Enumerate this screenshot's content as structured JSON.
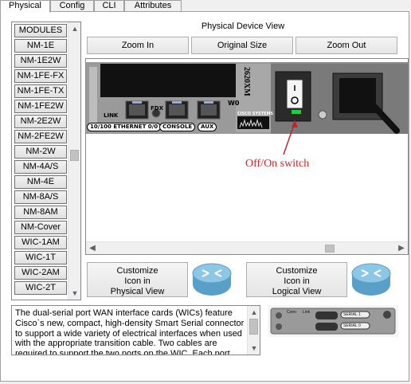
{
  "tabs": [
    {
      "label": "Physical",
      "active": true
    },
    {
      "label": "Config",
      "active": false
    },
    {
      "label": "CLI",
      "active": false
    },
    {
      "label": "Attributes",
      "active": false
    }
  ],
  "modules": [
    "MODULES",
    "NM-1E",
    "NM-1E2W",
    "NM-1FE-FX",
    "NM-1FE-TX",
    "NM-1FE2W",
    "NM-2E2W",
    "NM-2FE2W",
    "NM-2W",
    "NM-4A/S",
    "NM-4E",
    "NM-8A/S",
    "NM-8AM",
    "NM-Cover",
    "WIC-1AM",
    "WIC-1T",
    "WIC-2AM",
    "WIC-2T"
  ],
  "view": {
    "title": "Physical Device View",
    "zoom_in": "Zoom In",
    "original_size": "Original Size",
    "zoom_out": "Zoom Out"
  },
  "device": {
    "model": "2620XM",
    "link": "LINK",
    "fdx": "FDX",
    "w0": "W0",
    "ethernet": "10/100 ETHERNET 0/0",
    "console": "CONSOLE",
    "aux": "AUX",
    "brand": "CISCO SYSTEMS",
    "annotation": "Off/On switch"
  },
  "customize_physical": "Customize\nIcon in\nPhysical View",
  "customize_logical": "Customize\nIcon in\nLogical View",
  "description": "The dual-serial port WAN interface cards (WICs) feature Cisco`s new, compact, high-density Smart Serial connector to support a wide variety of electrical interfaces when used with the appropriate transition cable. Two cables are required to support the two ports on the WIC. Each port",
  "wic_labels": {
    "conn": "Conn",
    "link": "Link",
    "serial1": "SERIAL 1",
    "serial0": "SERIAL 0"
  },
  "colors": {
    "annotation": "#c0262c",
    "led": "#22cc44"
  }
}
